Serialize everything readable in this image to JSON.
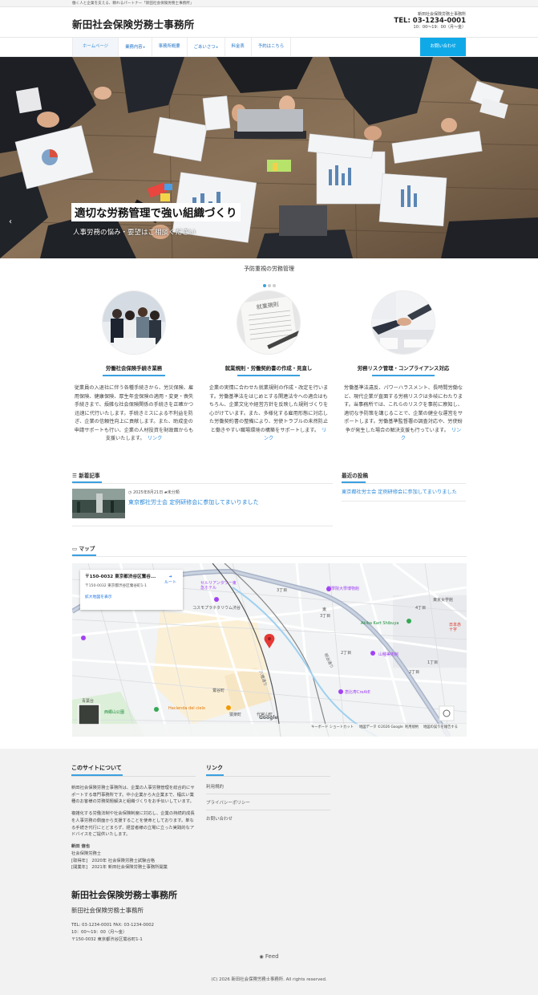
{
  "topbar": {
    "tagline": "働く人と企業を支える、頼れるパートナー「新田社会保険労務士事務所」"
  },
  "header": {
    "logo": "新田社会保険労務士事務所",
    "office_name": "新田社会保険労務士事務所",
    "tel": "TEL: 03-1234-0001",
    "hours": "10：00〜19：00（月〜金）"
  },
  "nav": {
    "items": [
      {
        "label": "ホームページ"
      },
      {
        "label": "業務内容",
        "dropdown": true
      },
      {
        "label": "事務所概要"
      },
      {
        "label": "ごあいさつ",
        "dropdown": true
      },
      {
        "label": "料金表"
      },
      {
        "label": "予約はこちら"
      }
    ],
    "contact": "お問い合わせ"
  },
  "hero": {
    "title": "適切な労務管理で強い組織づくり",
    "subtitle": "人事労務の悩み・要望はご相談ください"
  },
  "intro": {
    "title": "予防重視の労務管理",
    "features": [
      {
        "title": "労働社会保険手続き業務",
        "text": "従業員の入退社に伴う各種手続きから、労災保険、雇用保険、健康保険、厚生年金保険の適用・変更・喪失手続きまで、煩雑な社会保険関係の手続きを正確かつ迅速に代行いたします。手続きミスによる不利益を防ぎ、企業の信頼性向上に貢献します。また、助成金の申請サポートも行い、企業の人材投資を財政面からも支援いたします。",
        "link": "リンク"
      },
      {
        "title": "就業規則・労働契約書の作成・見直し",
        "text": "企業の実情に合わせた就業規則の作成・改定を行います。労働基準法をはじめとする関連法令への適合はもちろん、企業文化や経営方針を反映した規則づくりを心がけています。また、多様化する雇用形態に対応した労働契約書の整備により、労使トラブルの未然防止と働きやすい職場環境の構築をサポートします。",
        "link": "リンク"
      },
      {
        "title": "労務リスク管理・コンプライアンス対応",
        "text": "労働基準法違反、パワーハラスメント、長時間労働など、現代企業が直面する労務リスクは多岐にわたります。当事務所では、これらのリスクを事前に察知し、適切な予防策を講じることで、企業の健全な運営をサポートします。労働基準監督署の調査対応や、労使紛争が発生した場合の解決支援も行っています。",
        "link": "リンク"
      }
    ]
  },
  "news": {
    "title": "新着記事",
    "post": {
      "date": "2025年8月21日",
      "category": "未分類",
      "title": "東京都社労士会 定例研修会に参加してまいりました"
    }
  },
  "recent": {
    "title": "最近の投稿",
    "items": [
      "東京都社労士会 定例研修会に参加してまいりました"
    ]
  },
  "map": {
    "title": "マップ",
    "card": {
      "name": "〒150-0032 東京都渋谷区鶯谷...",
      "address": "〒150-0032 東京都渋谷区鶯谷町1-1",
      "route": "ルート",
      "enlarge": "拡大地図を表示"
    },
    "labels": {
      "museum": "國學院大學博物館",
      "school": "東京女学館",
      "kart": "Akiba Kart Shibuya",
      "zoo": "山種美術館",
      "cerulean": "セルリアンタワー東急ホテル",
      "cosmo": "コスモプラネタリウム渋谷",
      "kaminoya": "恵比寿CreAtE",
      "hacienda": "Hacienda del cielo",
      "uguisudani": "鶯谷町",
      "daikanyama": "代官山町",
      "sarugaku": "猿楽町",
      "higashi": "東",
      "chome3": "3丁目",
      "chome4": "4丁目",
      "chome2": "2丁目",
      "chome1": "1丁目",
      "chome2b": "2丁目",
      "rte": "日本赤十字",
      "aobadai": "青葉台",
      "saigoyama": "西郷山公園",
      "hachiman": "八幡通り",
      "meiji": "明治通り",
      "google": "Google",
      "kb": "キーボード ショートカット",
      "copy": "地図データ ©2026 Google",
      "terms": "利用規約",
      "report": "地図の誤りを報告する"
    }
  },
  "footer": {
    "about_title": "このサイトについて",
    "about_p1": "新田社会保険労務士事務所は、企業の人事労務管理を総合的にサポートする専門事務所です。中小企業から大企業まで、幅広い業種のお客様の労務問題解決と組織づくりをお手伝いしています。",
    "about_p2": "複雑化する労働法制や社会保険制度に対応し、企業の持続的成長を人事労務の側面から支援することを使命としております。単なる手続き代行にとどまらず、経営者様の立場に立った実践的なアドバイスをご提供いたします。",
    "person_name": "新田 信也",
    "person_title": "社会保険労務士",
    "person_l1": "[取得年]　2020年 社会保険労務士試験合格",
    "person_l2": "[開業年]　2021年 新田社会保険労務士事務所開業",
    "links_title": "リンク",
    "links": [
      "利用規約",
      "プライバシーポリシー",
      "お問い合わせ"
    ],
    "big_title": "新田社会保険労務士事務所",
    "sub_title": "新田社会保険労務士事務所",
    "contact_l1": "TEL: 03-1234-0001 FAX: 03-1234-0002",
    "contact_l2": "10：00〜19：00（月〜金）",
    "contact_l3": "〒150-0032 東京都渋谷区鶯谷町1-1",
    "feed": "Feed",
    "copyright": "(C) 2026 新田社会保険労務士事務所. All rights reserved."
  },
  "colors": {
    "accent": "#10a9e8",
    "link": "#2a88d8",
    "underline": "#3aa0e0"
  }
}
